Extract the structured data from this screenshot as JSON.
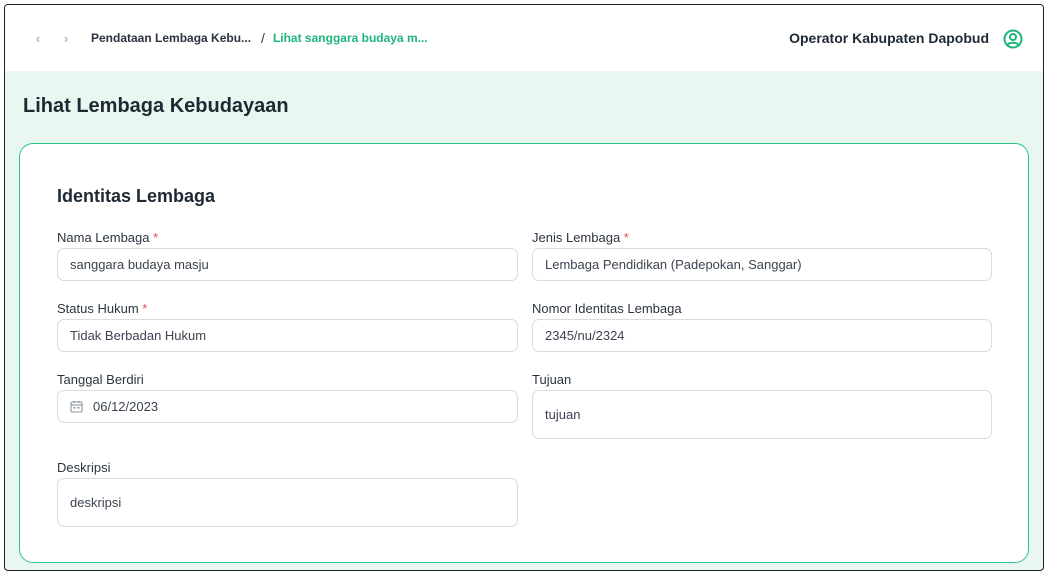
{
  "breadcrumb": {
    "parent": "Pendataan Lembaga Kebu...",
    "separator": "/",
    "current": "Lihat sanggara budaya m..."
  },
  "user": {
    "name": "Operator Kabupaten Dapobud"
  },
  "page": {
    "title": "Lihat Lembaga Kebudayaan"
  },
  "form": {
    "section_title": "Identitas Lembaga",
    "required_marker": "*",
    "fields": {
      "nama_lembaga": {
        "label": "Nama Lembaga",
        "value": "sanggara budaya masju"
      },
      "jenis_lembaga": {
        "label": "Jenis Lembaga",
        "value": "Lembaga Pendidikan (Padepokan, Sanggar)"
      },
      "status_hukum": {
        "label": "Status Hukum",
        "value": "Tidak Berbadan Hukum"
      },
      "nomor_identitas": {
        "label": "Nomor Identitas Lembaga",
        "value": "2345/nu/2324"
      },
      "tanggal_berdiri": {
        "label": "Tanggal Berdiri",
        "value": "06/12/2023"
      },
      "tujuan": {
        "label": "Tujuan",
        "value": "tujuan"
      },
      "deskripsi": {
        "label": "Deskripsi",
        "value": "deskripsi"
      }
    }
  },
  "icons": {
    "back": "chevron-left-icon",
    "forward": "chevron-right-icon",
    "user": "user-circle-icon",
    "calendar": "calendar-icon"
  },
  "colors": {
    "accent": "#1fb57a",
    "card_border": "#2ec58a",
    "background": "#eaf7f1",
    "required": "#e5484d"
  }
}
